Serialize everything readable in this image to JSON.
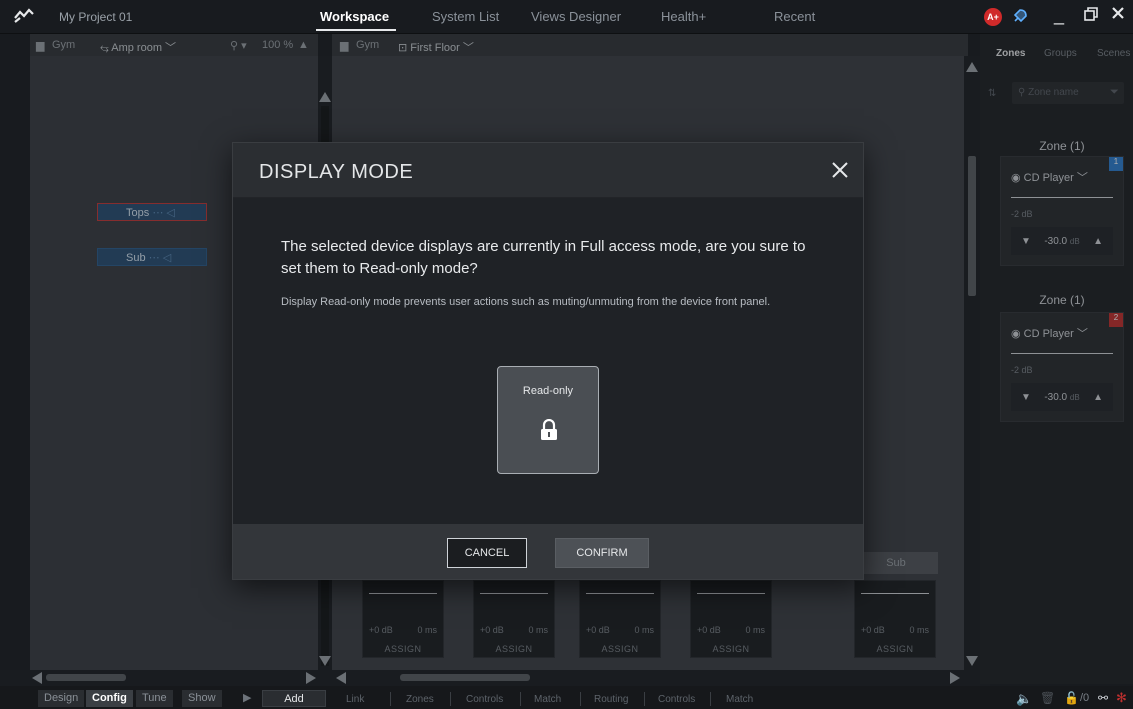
{
  "topbar": {
    "project_name": "My Project 01",
    "tabs": [
      {
        "label": "Workspace",
        "active": true
      },
      {
        "label": "System List",
        "active": false
      },
      {
        "label": "Views Designer",
        "active": false
      },
      {
        "label": "Health+",
        "active": false
      },
      {
        "label": "Recent",
        "active": false
      }
    ],
    "badge": "A+"
  },
  "left_panel": {
    "breadcrumb_root": "Gym",
    "room": "Amp room",
    "zoom": "100 %",
    "devices": [
      {
        "label": "Tops"
      },
      {
        "label": "Sub"
      }
    ]
  },
  "center_panel": {
    "breadcrumb_root": "Gym",
    "floor": "First Floor",
    "sub_label": "Sub",
    "channels": [
      {
        "gain": "+0 dB",
        "delay": "0 ms",
        "assign": "ASSIGN"
      },
      {
        "gain": "+0 dB",
        "delay": "0 ms",
        "assign": "ASSIGN"
      },
      {
        "gain": "+0 dB",
        "delay": "0 ms",
        "assign": "ASSIGN"
      },
      {
        "gain": "+0 dB",
        "delay": "0 ms",
        "assign": "ASSIGN"
      },
      {
        "gain": "+0 dB",
        "delay": "0 ms",
        "assign": "ASSIGN"
      }
    ]
  },
  "right_panel": {
    "tabs": [
      {
        "label": "Zones",
        "active": true
      },
      {
        "label": "Groups",
        "active": false
      },
      {
        "label": "Scenes",
        "active": false
      }
    ],
    "search_placeholder": "Zone name",
    "zones": [
      {
        "title": "Zone (1)",
        "source": "CD Player",
        "gain": "-2 dB",
        "value": "-30.0",
        "unit": "dB",
        "badge": "1",
        "badge_color": "#2f7fd0"
      },
      {
        "title": "Zone (1)",
        "source": "CD Player",
        "gain": "-2 dB",
        "value": "-30.0",
        "unit": "dB",
        "badge": "2",
        "badge_color": "#c0302f"
      }
    ]
  },
  "bottombar": {
    "modes": [
      {
        "label": "Design",
        "active": false
      },
      {
        "label": "Config",
        "active": true
      },
      {
        "label": "Tune",
        "active": false
      },
      {
        "label": "Show",
        "active": false
      }
    ],
    "add_label": "Add",
    "links": [
      "Link",
      "Zones",
      "Controls",
      "Match",
      "Routing",
      "Controls",
      "Match"
    ],
    "counter": "/0"
  },
  "modal": {
    "title": "DISPLAY MODE",
    "question": "The selected device displays are currently in Full access mode, are you sure to set them to Read-only mode?",
    "note": "Display Read-only mode prevents user actions such as muting/unmuting from the device front panel.",
    "option_label": "Read-only",
    "cancel_label": "CANCEL",
    "confirm_label": "CONFIRM"
  }
}
